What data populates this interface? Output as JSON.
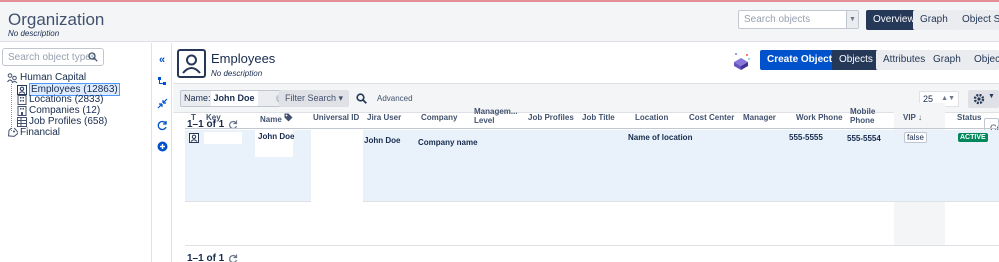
{
  "header": {
    "title": "Organization",
    "description": "No description",
    "search_placeholder": "Search objects",
    "buttons": [
      "Overview",
      "Graph",
      "Object Sc"
    ]
  },
  "sidebar": {
    "search_placeholder": "Search object types",
    "tree": [
      {
        "label": "Human Capital",
        "icon": "org-chart-icon"
      },
      {
        "label": "Employees (12863)",
        "icon": "person-icon",
        "selected": true
      },
      {
        "label": "Locations (2833)",
        "icon": "building-icon"
      },
      {
        "label": "Companies (12)",
        "icon": "building-icon"
      },
      {
        "label": "Job Profiles (658)",
        "icon": "table-icon"
      },
      {
        "label": "Financial",
        "icon": "tag-icon"
      }
    ]
  },
  "object_type": {
    "title": "Employees",
    "description": "No description",
    "create_button": "Create Object",
    "tabs": [
      "Objects",
      "Attributes",
      "Graph",
      "Object"
    ]
  },
  "filter": {
    "chip_label": "Name:",
    "chip_value": "John Doe",
    "filter_search": "Filter Search",
    "advanced": "Advanced",
    "page_size": "25"
  },
  "pagination": {
    "top": "1–1 of 1",
    "bottom": "1–1 of 1"
  },
  "columns_button": "Co",
  "table": {
    "headers": [
      "T",
      "Key",
      "Name",
      "Universal ID",
      "Jira User",
      "Company",
      "Managem... Level",
      "Job Profiles",
      "Job Title",
      "Location",
      "Cost Center",
      "Manager",
      "Work Phone",
      "Mobile Phone",
      "VIP",
      "Status"
    ],
    "rows": [
      {
        "name": "John Doe",
        "jira_user": "John Doe",
        "company": "Company name",
        "location": "Name of location",
        "work_phone": "555-5555",
        "mobile_phone": "555-5554",
        "vip": "false",
        "status": "ACTIVE"
      }
    ]
  },
  "colors": {
    "primary": "#0052cc",
    "dark": "#253858",
    "active_badge": "#00875a",
    "top_accent": "#e58e95"
  }
}
